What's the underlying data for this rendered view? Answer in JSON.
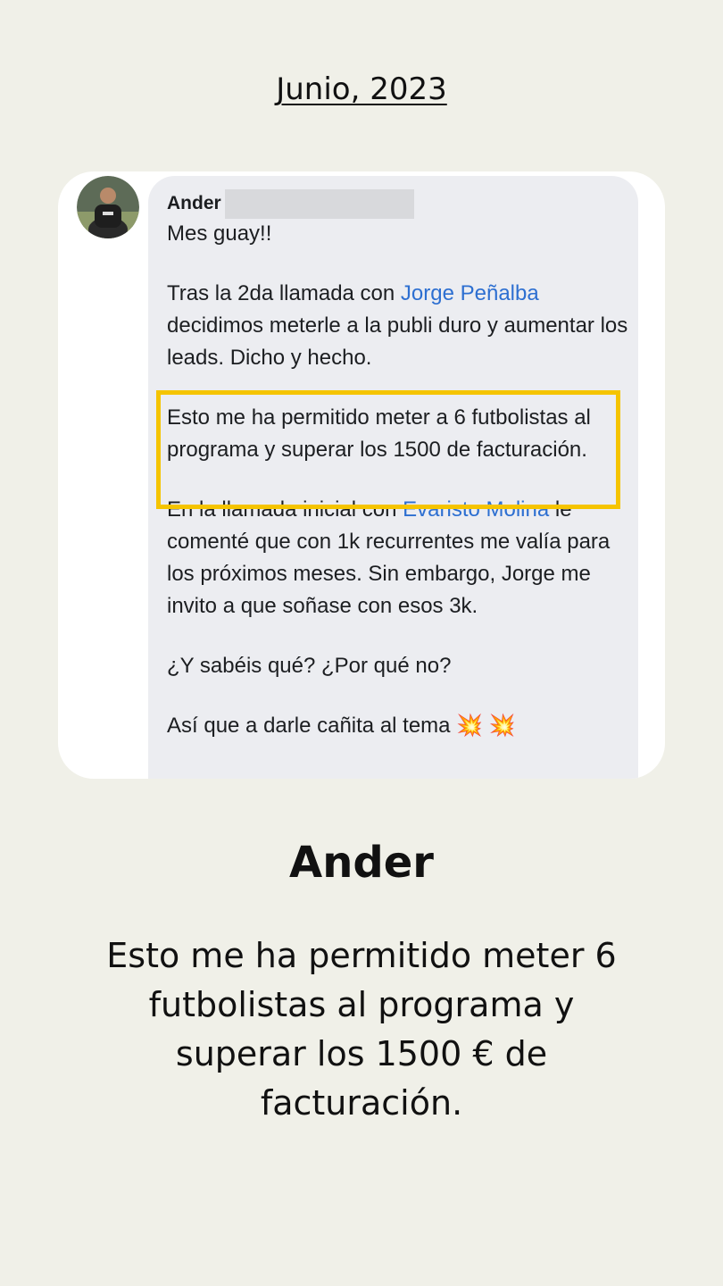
{
  "date": "Junio, 2023",
  "message": {
    "sender": "Ander",
    "greeting": "Mes guay!!",
    "p1_a": "Tras la 2da llamada con ",
    "p1_mention": "Jorge Peñalba",
    "p1_b": " decidimos meterle a la publi duro y aumentar los leads. Dicho y hecho.",
    "p2": "Esto me ha permitido meter a 6 futbolistas al programa y superar los 1500 de facturación.",
    "p3_a": "En la llamada inicial con ",
    "p3_mention": "Evaristo Molina",
    "p3_b": " le comenté que con 1k recurrentes me valía para los próximos meses. Sin embargo, Jorge me invito a que soñase con esos 3k.",
    "p4": "¿Y sabéis qué? ¿Por qué no?",
    "p5": "Así que a darle cañita al tema",
    "p5_emoji": "💥 💥"
  },
  "testimonial": {
    "name": "Ander",
    "quote": "Esto me ha permitido meter 6 futbolistas al programa y superar los 1500 € de facturación."
  },
  "colors": {
    "background": "#f0f0e8",
    "bubble": "#ecedf1",
    "mention": "#2d6fd1",
    "highlight": "#f5c400"
  }
}
